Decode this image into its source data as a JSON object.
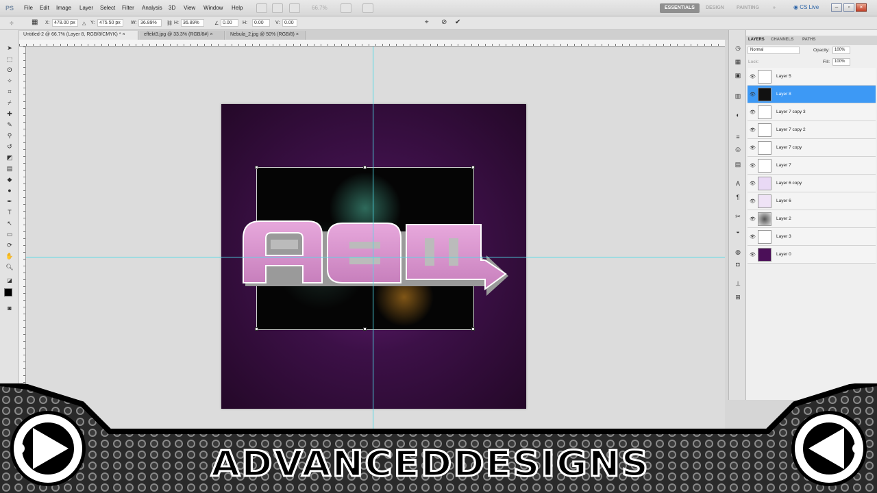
{
  "menubar": {
    "logo": "PS",
    "items": [
      "File",
      "Edit",
      "Image",
      "Layer",
      "Select",
      "Filter",
      "Analysis",
      "3D",
      "View",
      "Window",
      "Help"
    ],
    "zoom": "66.7%",
    "workspaces": [
      "ESSENTIALS",
      "DESIGN",
      "PAINTING"
    ],
    "cs_live": "CS Live"
  },
  "options": {
    "x_label": "X:",
    "x_value": "478.00 px",
    "y_label": "Y:",
    "y_value": "475.50 px",
    "w_label": "W:",
    "w_value": "36.89%",
    "h_label": "H:",
    "h_value": "36.89%",
    "angle_value": "0.00",
    "hskew_label": "H:",
    "hskew_value": "0.00",
    "vskew_label": "V:",
    "vskew_value": "0.00"
  },
  "tabs": [
    {
      "label": "Untitled-2 @ 66.7% (Layer 8, RGB/8/CMYK) *"
    },
    {
      "label": "effekt3.jpg @ 33.3% (RGB/8#)"
    },
    {
      "label": "Nebula_2.jpg @ 50% (RGB/8)"
    }
  ],
  "layers_panel": {
    "tabs": [
      "LAYERS",
      "CHANNELS",
      "PATHS"
    ],
    "blend_mode": "Normal",
    "opacity_label": "Opacity:",
    "opacity": "100%",
    "lock_label": "Lock:",
    "fill_label": "Fill:",
    "fill": "100%",
    "layers": [
      {
        "name": "Layer 5"
      },
      {
        "name": "Layer 8"
      },
      {
        "name": "Layer 7 copy 3"
      },
      {
        "name": "Layer 7 copy 2"
      },
      {
        "name": "Layer 7 copy"
      },
      {
        "name": "Layer 7"
      },
      {
        "name": "Layer 6 copy"
      },
      {
        "name": "Layer 6"
      },
      {
        "name": "Layer 2"
      },
      {
        "name": "Layer 3"
      },
      {
        "name": "Layer 0"
      }
    ]
  },
  "canvas": {
    "text_art": "New"
  },
  "banner": {
    "brand": "ADVANCEDDESIGNS"
  },
  "colors": {
    "selection": "#3d99f5",
    "guide": "#4ed9e6",
    "canvas_bg": "#3c1047"
  }
}
